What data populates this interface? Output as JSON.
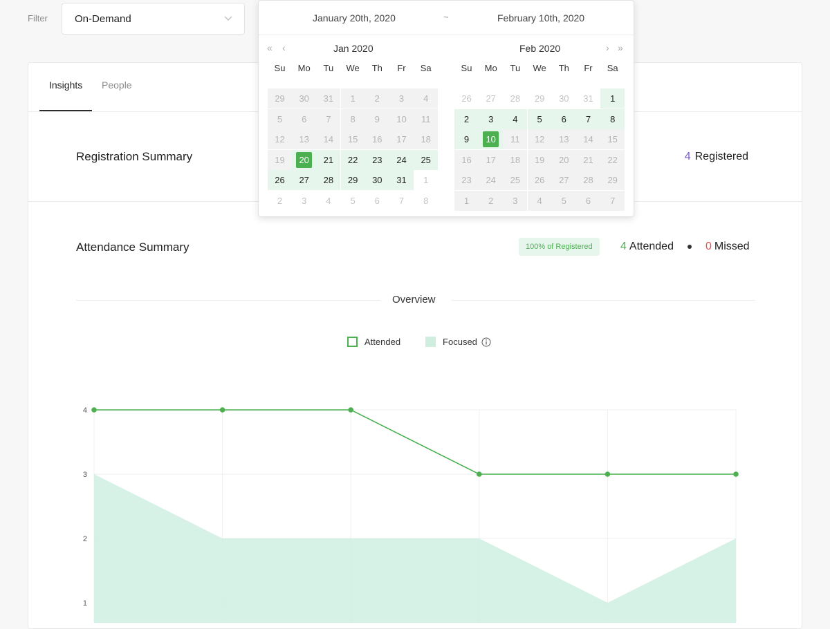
{
  "filter": {
    "label": "Filter",
    "value": "On-Demand"
  },
  "tabs": [
    {
      "label": "Insights"
    },
    {
      "label": "People"
    }
  ],
  "registration": {
    "title": "Registration Summary",
    "count": "4",
    "count_label": "Registered"
  },
  "attendance": {
    "title": "Attendance Summary",
    "badge": "100% of Registered",
    "attended_count": "4",
    "attended_label": "Attended",
    "missed_count": "0",
    "missed_label": "Missed"
  },
  "overview": {
    "title": "Overview"
  },
  "legend": {
    "attended": "Attended",
    "focused": "Focused"
  },
  "colors": {
    "green": "#4caf50",
    "focused_fill": "#cfeee0",
    "purple": "#7c5cd6",
    "red": "#e05252"
  },
  "date_picker": {
    "start": "January 20th, 2020",
    "separator": "~",
    "end": "February 10th, 2020",
    "weekdays": [
      "Su",
      "Mo",
      "Tu",
      "We",
      "Th",
      "Fr",
      "Sa"
    ],
    "left": {
      "title": "Jan 2020",
      "weeks": [
        [
          [
            "29",
            "dis"
          ],
          [
            "30",
            "dis"
          ],
          [
            "31",
            "dis"
          ],
          [
            "1",
            "dis"
          ],
          [
            "2",
            "dis"
          ],
          [
            "3",
            "dis"
          ],
          [
            "4",
            "dis"
          ]
        ],
        [
          [
            "5",
            "dis"
          ],
          [
            "6",
            "dis"
          ],
          [
            "7",
            "dis"
          ],
          [
            "8",
            "dis"
          ],
          [
            "9",
            "dis"
          ],
          [
            "10",
            "dis"
          ],
          [
            "11",
            "dis"
          ]
        ],
        [
          [
            "12",
            "dis"
          ],
          [
            "13",
            "dis"
          ],
          [
            "14",
            "dis"
          ],
          [
            "15",
            "dis"
          ],
          [
            "16",
            "dis"
          ],
          [
            "17",
            "dis"
          ],
          [
            "18",
            "dis"
          ]
        ],
        [
          [
            "19",
            "dis"
          ],
          [
            "20",
            "sel"
          ],
          [
            "21",
            "inr"
          ],
          [
            "22",
            "inr"
          ],
          [
            "23",
            "inr"
          ],
          [
            "24",
            "inr"
          ],
          [
            "25",
            "inr"
          ]
        ],
        [
          [
            "26",
            "inr"
          ],
          [
            "27",
            "inr"
          ],
          [
            "28",
            "inr"
          ],
          [
            "29",
            "inr"
          ],
          [
            "30",
            "inr"
          ],
          [
            "31",
            "inr"
          ],
          [
            "1",
            "other"
          ]
        ],
        [
          [
            "2",
            "other"
          ],
          [
            "3",
            "other"
          ],
          [
            "4",
            "other"
          ],
          [
            "5",
            "other"
          ],
          [
            "6",
            "other"
          ],
          [
            "7",
            "other"
          ],
          [
            "8",
            "other"
          ]
        ]
      ]
    },
    "right": {
      "title": "Feb 2020",
      "weeks": [
        [
          [
            "26",
            "other"
          ],
          [
            "27",
            "other"
          ],
          [
            "28",
            "other"
          ],
          [
            "29",
            "other"
          ],
          [
            "30",
            "other"
          ],
          [
            "31",
            "other"
          ],
          [
            "1",
            "inr"
          ]
        ],
        [
          [
            "2",
            "inr"
          ],
          [
            "3",
            "inr"
          ],
          [
            "4",
            "inr"
          ],
          [
            "5",
            "inr"
          ],
          [
            "6",
            "inr"
          ],
          [
            "7",
            "inr"
          ],
          [
            "8",
            "inr"
          ]
        ],
        [
          [
            "9",
            "inr"
          ],
          [
            "10",
            "sel"
          ],
          [
            "11",
            "dis"
          ],
          [
            "12",
            "dis"
          ],
          [
            "13",
            "dis"
          ],
          [
            "14",
            "dis"
          ],
          [
            "15",
            "dis"
          ]
        ],
        [
          [
            "16",
            "dis"
          ],
          [
            "17",
            "dis"
          ],
          [
            "18",
            "dis"
          ],
          [
            "19",
            "dis"
          ],
          [
            "20",
            "dis"
          ],
          [
            "21",
            "dis"
          ],
          [
            "22",
            "dis"
          ]
        ],
        [
          [
            "23",
            "dis"
          ],
          [
            "24",
            "dis"
          ],
          [
            "25",
            "dis"
          ],
          [
            "26",
            "dis"
          ],
          [
            "27",
            "dis"
          ],
          [
            "28",
            "dis"
          ],
          [
            "29",
            "dis"
          ]
        ],
        [
          [
            "1",
            "dis"
          ],
          [
            "2",
            "dis"
          ],
          [
            "3",
            "dis"
          ],
          [
            "4",
            "dis"
          ],
          [
            "5",
            "dis"
          ],
          [
            "6",
            "dis"
          ],
          [
            "7",
            "dis"
          ]
        ]
      ]
    },
    "icons": {
      "prev_year": "double-chevron-left-icon",
      "prev_month": "chevron-left-icon",
      "next_month": "chevron-right-icon",
      "next_year": "double-chevron-right-icon"
    }
  },
  "chart_data": {
    "type": "line",
    "x_count": 6,
    "ylim": [
      0,
      4
    ],
    "yticks": [
      "1",
      "2",
      "3",
      "4"
    ],
    "series": [
      {
        "name": "Attended",
        "style": "line",
        "values": [
          4,
          4,
          4,
          3,
          3,
          3
        ]
      },
      {
        "name": "Focused",
        "style": "area",
        "values": [
          3,
          2,
          2,
          2,
          1,
          2
        ]
      }
    ]
  }
}
